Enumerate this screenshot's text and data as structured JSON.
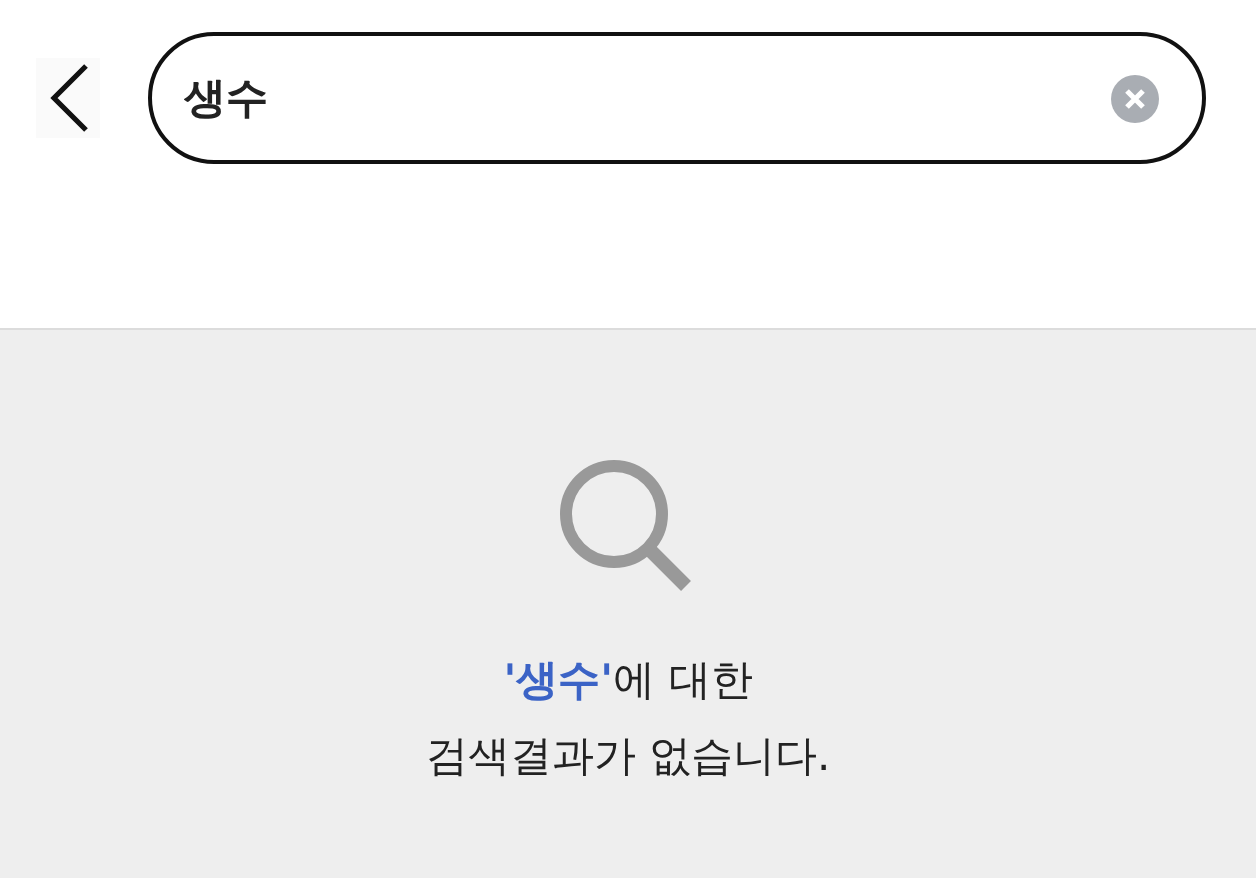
{
  "search": {
    "value": "생수"
  },
  "empty_state": {
    "message": "**'생수'**에 대한",
    "detail": "검색결과가 없습니다."
  }
}
